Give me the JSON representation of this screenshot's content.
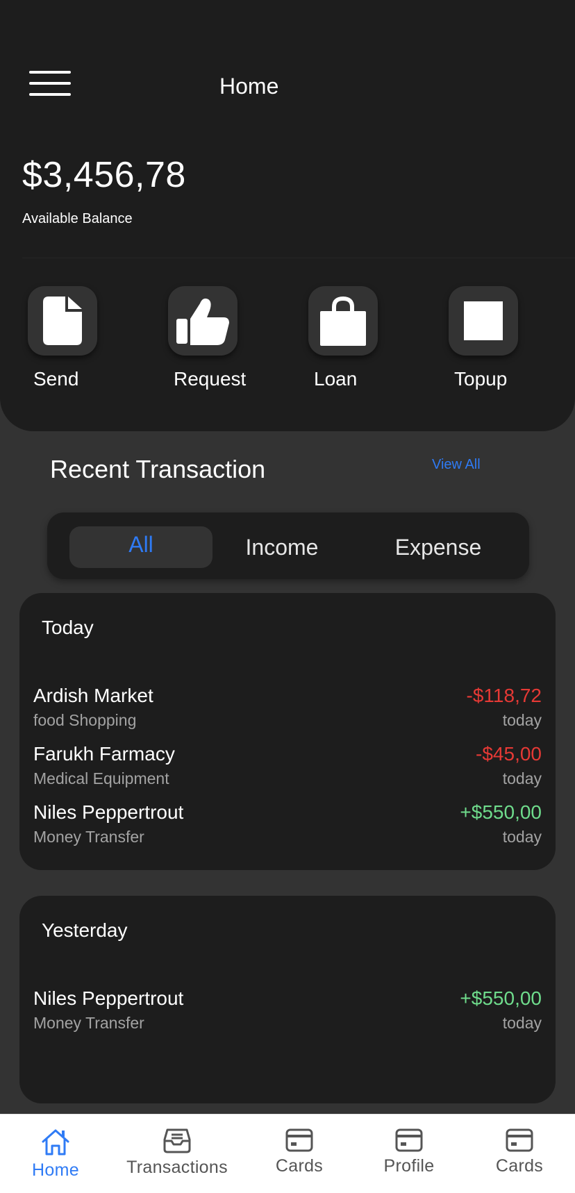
{
  "header": {
    "title": "Home"
  },
  "balance": {
    "amount": "$3,456,78",
    "label": "Available Balance"
  },
  "actions": [
    {
      "label": "Send",
      "icon": "file-icon"
    },
    {
      "label": "Request",
      "icon": "thumbs-up-icon"
    },
    {
      "label": "Loan",
      "icon": "shopping-bag-icon"
    },
    {
      "label": "Topup",
      "icon": "square-icon"
    }
  ],
  "recent": {
    "title": "Recent Transaction",
    "view_all": "View All"
  },
  "filters": {
    "all": "All",
    "income": "Income",
    "expense": "Expense",
    "selected": "All"
  },
  "groups": [
    {
      "title": "Today",
      "transactions": [
        {
          "name": "Ardish Market",
          "category": "food Shopping",
          "amount": "-$118,72",
          "when": "today"
        },
        {
          "name": "Farukh Farmacy",
          "category": "Medical Equipment",
          "amount": "-$45,00",
          "when": "today"
        },
        {
          "name": "Niles Peppertrout",
          "category": "Money Transfer",
          "amount": "+$550,00",
          "when": "today"
        }
      ]
    },
    {
      "title": "Yesterday",
      "transactions": [
        {
          "name": "Niles Peppertrout",
          "category": "Money Transfer",
          "amount": "+$550,00",
          "when": "today"
        }
      ]
    }
  ],
  "nav": [
    {
      "label": "Home",
      "icon": "home-icon",
      "active": true
    },
    {
      "label": "Transactions",
      "icon": "inbox-icon",
      "active": false
    },
    {
      "label": "Cards",
      "icon": "credit-card-icon",
      "active": false
    },
    {
      "label": "Profile",
      "icon": "credit-card-icon",
      "active": false
    },
    {
      "label": "Cards",
      "icon": "credit-card-icon",
      "active": false
    }
  ],
  "colors": {
    "accent": "#2f7bf5",
    "expense": "#e53935",
    "income": "#6fdc8c",
    "panel": "#1d1d1d",
    "background": "#333333"
  }
}
